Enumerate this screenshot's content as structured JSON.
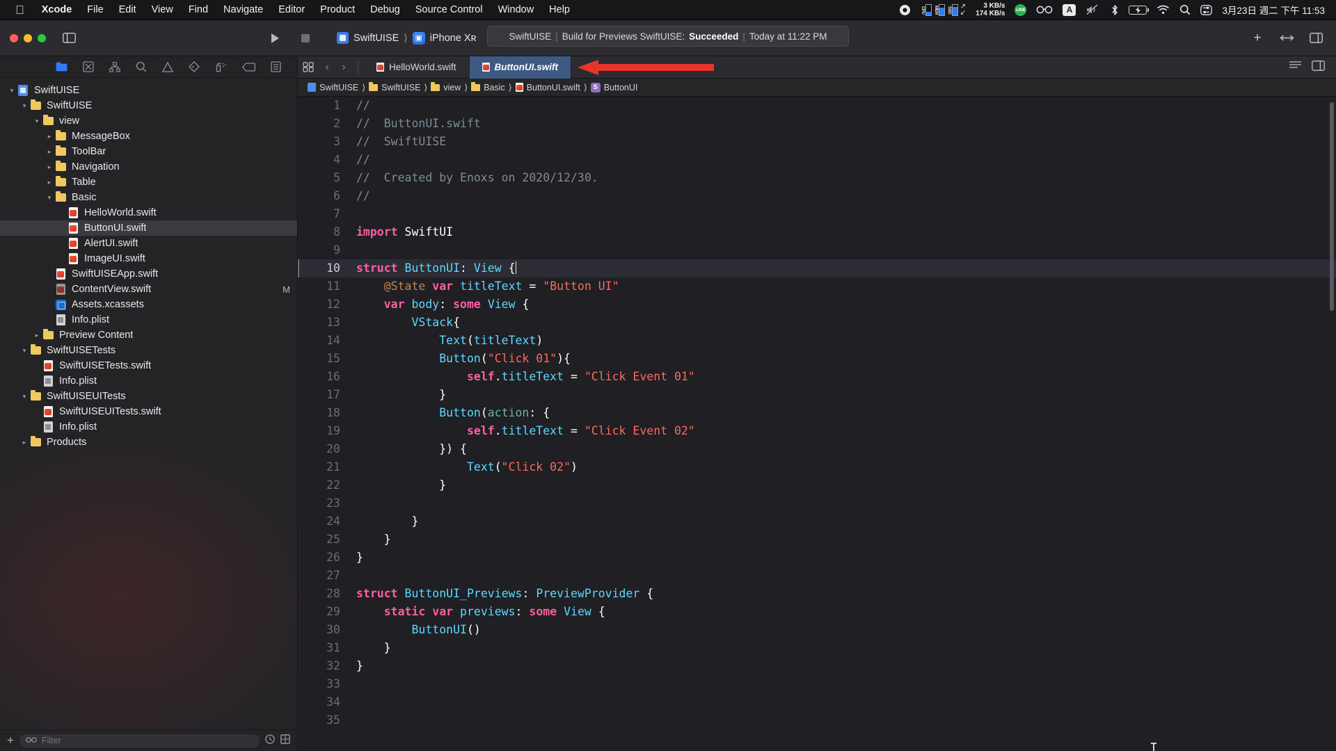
{
  "menubar": {
    "apple": "apple-logo",
    "items": [
      "Xcode",
      "File",
      "Edit",
      "View",
      "Find",
      "Navigate",
      "Editor",
      "Product",
      "Debug",
      "Source Control",
      "Window",
      "Help"
    ],
    "app_name": "Xcode",
    "status": {
      "record_icon": "record-icon",
      "cpu_label": "CPU",
      "mem_label": "MEM",
      "ssd_label": "SSD",
      "net_up": "3 KB/s",
      "net_down": "174 KB/s",
      "line_icon": "LINE",
      "glasses_icon": "glasses-icon",
      "input_source": "A",
      "volume_icon": "volume-muted-icon",
      "bluetooth_icon": "bluetooth-icon",
      "battery_icon": "battery-charging-icon",
      "wifi_icon": "wifi-icon",
      "search_icon": "search-icon",
      "control_center_icon": "control-center-icon",
      "datetime": "3月23日 週二 下午 11:53"
    }
  },
  "toolbar": {
    "sidebar_toggle": "sidebar-toggle-icon",
    "run_button": "run-button",
    "stop_button": "stop-button",
    "scheme": "SwiftUISE",
    "destination": "iPhone Xʀ",
    "activity": {
      "project": "SwiftUISE",
      "action": "Build for Previews SwiftUISE:",
      "result": "Succeeded",
      "time": "Today at 11:22 PM"
    },
    "add_button": "+",
    "right_icons": [
      "library-add-icon",
      "inspector-toggle-icon"
    ]
  },
  "navigator": {
    "tabs": [
      {
        "name": "project-navigator",
        "icon": "folder-icon",
        "active": true
      },
      {
        "name": "source-control-navigator",
        "icon": "source-control-icon",
        "active": false
      },
      {
        "name": "symbol-navigator",
        "icon": "hierarchy-icon",
        "active": false
      },
      {
        "name": "find-navigator",
        "icon": "search-icon",
        "active": false
      },
      {
        "name": "issue-navigator",
        "icon": "warning-icon",
        "active": false
      },
      {
        "name": "test-navigator",
        "icon": "diamond-icon",
        "active": false
      },
      {
        "name": "debug-navigator",
        "icon": "spray-icon",
        "active": false
      },
      {
        "name": "breakpoint-navigator",
        "icon": "tag-icon",
        "active": false
      },
      {
        "name": "report-navigator",
        "icon": "report-icon",
        "active": false
      }
    ],
    "tree": [
      {
        "label": "SwiftUISE",
        "depth": 0,
        "icon": "project",
        "twisty": "open",
        "selected": false,
        "status": ""
      },
      {
        "label": "SwiftUISE",
        "depth": 1,
        "icon": "folder",
        "twisty": "open",
        "selected": false,
        "status": ""
      },
      {
        "label": "view",
        "depth": 2,
        "icon": "folder",
        "twisty": "open",
        "selected": false,
        "status": ""
      },
      {
        "label": "MessageBox",
        "depth": 3,
        "icon": "folder",
        "twisty": "closed",
        "selected": false,
        "status": ""
      },
      {
        "label": "ToolBar",
        "depth": 3,
        "icon": "folder",
        "twisty": "closed",
        "selected": false,
        "status": ""
      },
      {
        "label": "Navigation",
        "depth": 3,
        "icon": "folder",
        "twisty": "closed",
        "selected": false,
        "status": ""
      },
      {
        "label": "Table",
        "depth": 3,
        "icon": "folder",
        "twisty": "closed",
        "selected": false,
        "status": ""
      },
      {
        "label": "Basic",
        "depth": 3,
        "icon": "folder",
        "twisty": "open",
        "selected": false,
        "status": ""
      },
      {
        "label": "HelloWorld.swift",
        "depth": 4,
        "icon": "swift",
        "twisty": "none",
        "selected": false,
        "status": ""
      },
      {
        "label": "ButtonUI.swift",
        "depth": 4,
        "icon": "swift",
        "twisty": "none",
        "selected": true,
        "status": ""
      },
      {
        "label": "AlertUI.swift",
        "depth": 4,
        "icon": "swift",
        "twisty": "none",
        "selected": false,
        "status": ""
      },
      {
        "label": "ImageUI.swift",
        "depth": 4,
        "icon": "swift",
        "twisty": "none",
        "selected": false,
        "status": ""
      },
      {
        "label": "SwiftUISEApp.swift",
        "depth": 3,
        "icon": "swift",
        "twisty": "none",
        "selected": false,
        "status": ""
      },
      {
        "label": "ContentView.swift",
        "depth": 3,
        "icon": "swift-dim",
        "twisty": "none",
        "selected": false,
        "status": "M"
      },
      {
        "label": "Assets.xcassets",
        "depth": 3,
        "icon": "assets",
        "twisty": "none",
        "selected": false,
        "status": ""
      },
      {
        "label": "Info.plist",
        "depth": 3,
        "icon": "plist",
        "twisty": "none",
        "selected": false,
        "status": ""
      },
      {
        "label": "Preview Content",
        "depth": 2,
        "icon": "folder",
        "twisty": "closed",
        "selected": false,
        "status": ""
      },
      {
        "label": "SwiftUISETests",
        "depth": 1,
        "icon": "folder",
        "twisty": "open",
        "selected": false,
        "status": ""
      },
      {
        "label": "SwiftUISETests.swift",
        "depth": 2,
        "icon": "swift",
        "twisty": "none",
        "selected": false,
        "status": ""
      },
      {
        "label": "Info.plist",
        "depth": 2,
        "icon": "plist",
        "twisty": "none",
        "selected": false,
        "status": ""
      },
      {
        "label": "SwiftUISEUITests",
        "depth": 1,
        "icon": "folder",
        "twisty": "open",
        "selected": false,
        "status": ""
      },
      {
        "label": "SwiftUISEUITests.swift",
        "depth": 2,
        "icon": "swift",
        "twisty": "none",
        "selected": false,
        "status": ""
      },
      {
        "label": "Info.plist",
        "depth": 2,
        "icon": "plist",
        "twisty": "none",
        "selected": false,
        "status": ""
      },
      {
        "label": "Products",
        "depth": 1,
        "icon": "folder",
        "twisty": "closed",
        "selected": false,
        "status": ""
      }
    ],
    "footer": {
      "add_label": "+",
      "filter_placeholder": "Filter",
      "filter_value": "",
      "recent_icon": "clock-icon",
      "sourcecontrol_icon": "filter-sc-icon"
    }
  },
  "editor": {
    "tabs": [
      {
        "label": "HelloWorld.swift",
        "active": false
      },
      {
        "label": "ButtonUI.swift",
        "active": true
      }
    ],
    "annotation": {
      "type": "red-arrow",
      "color": "#e8342a"
    },
    "breadcrumb": [
      {
        "label": "SwiftUISE",
        "icon": "project"
      },
      {
        "label": "SwiftUISE",
        "icon": "folder"
      },
      {
        "label": "view",
        "icon": "folder"
      },
      {
        "label": "Basic",
        "icon": "folder"
      },
      {
        "label": "ButtonUI.swift",
        "icon": "swift"
      },
      {
        "label": "ButtonUI",
        "icon": "symbol-s"
      }
    ],
    "current_line": 10,
    "code": [
      {
        "n": 1,
        "t": [
          [
            "cm",
            "//"
          ]
        ]
      },
      {
        "n": 2,
        "t": [
          [
            "cm",
            "//  ButtonUI.swift"
          ]
        ]
      },
      {
        "n": 3,
        "t": [
          [
            "cm",
            "//  SwiftUISE"
          ]
        ]
      },
      {
        "n": 4,
        "t": [
          [
            "cm",
            "//"
          ]
        ]
      },
      {
        "n": 5,
        "t": [
          [
            "cm",
            "//  Created by Enoxs on 2020/12/30."
          ]
        ]
      },
      {
        "n": 6,
        "t": [
          [
            "cm",
            "//"
          ]
        ]
      },
      {
        "n": 7,
        "t": []
      },
      {
        "n": 8,
        "t": [
          [
            "k",
            "import"
          ],
          [
            "pl",
            " SwiftUI"
          ]
        ]
      },
      {
        "n": 9,
        "t": []
      },
      {
        "n": 10,
        "t": [
          [
            "k",
            "struct"
          ],
          [
            "pl",
            " "
          ],
          [
            "ty",
            "ButtonUI"
          ],
          [
            "pl",
            ": "
          ],
          [
            "ty",
            "View"
          ],
          [
            "pl",
            " {"
          ]
        ],
        "caret": true
      },
      {
        "n": 11,
        "t": [
          [
            "pl",
            "    "
          ],
          [
            "at",
            "@State"
          ],
          [
            "pl",
            " "
          ],
          [
            "k",
            "var"
          ],
          [
            "pl",
            " "
          ],
          [
            "ty",
            "titleText"
          ],
          [
            "pl",
            " = "
          ],
          [
            "st",
            "\"Button UI\""
          ]
        ]
      },
      {
        "n": 12,
        "t": [
          [
            "pl",
            "    "
          ],
          [
            "k",
            "var"
          ],
          [
            "pl",
            " "
          ],
          [
            "ty",
            "body"
          ],
          [
            "pl",
            ": "
          ],
          [
            "k",
            "some"
          ],
          [
            "pl",
            " "
          ],
          [
            "ty",
            "View"
          ],
          [
            "pl",
            " {"
          ]
        ]
      },
      {
        "n": 13,
        "t": [
          [
            "pl",
            "        "
          ],
          [
            "ty",
            "VStack"
          ],
          [
            "pl",
            "{"
          ]
        ]
      },
      {
        "n": 14,
        "t": [
          [
            "pl",
            "            "
          ],
          [
            "ty",
            "Text"
          ],
          [
            "pl",
            "("
          ],
          [
            "ty",
            "titleText"
          ],
          [
            "pl",
            ")"
          ]
        ]
      },
      {
        "n": 15,
        "t": [
          [
            "pl",
            "            "
          ],
          [
            "ty",
            "Button"
          ],
          [
            "pl",
            "("
          ],
          [
            "st",
            "\"Click 01\""
          ],
          [
            "pl",
            "){"
          ]
        ]
      },
      {
        "n": 16,
        "t": [
          [
            "pl",
            "                "
          ],
          [
            "k",
            "self"
          ],
          [
            "pl",
            "."
          ],
          [
            "ty",
            "titleText"
          ],
          [
            "pl",
            " = "
          ],
          [
            "st",
            "\"Click Event 01\""
          ]
        ]
      },
      {
        "n": 17,
        "t": [
          [
            "pl",
            "            }"
          ]
        ]
      },
      {
        "n": 18,
        "t": [
          [
            "pl",
            "            "
          ],
          [
            "ty",
            "Button"
          ],
          [
            "pl",
            "("
          ],
          [
            "fn",
            "action"
          ],
          [
            "pl",
            ": {"
          ]
        ]
      },
      {
        "n": 19,
        "t": [
          [
            "pl",
            "                "
          ],
          [
            "k",
            "self"
          ],
          [
            "pl",
            "."
          ],
          [
            "ty",
            "titleText"
          ],
          [
            "pl",
            " = "
          ],
          [
            "st",
            "\"Click Event 02\""
          ]
        ]
      },
      {
        "n": 20,
        "t": [
          [
            "pl",
            "            }) {"
          ]
        ]
      },
      {
        "n": 21,
        "t": [
          [
            "pl",
            "                "
          ],
          [
            "ty",
            "Text"
          ],
          [
            "pl",
            "("
          ],
          [
            "st",
            "\"Click 02\""
          ],
          [
            "pl",
            ")"
          ]
        ]
      },
      {
        "n": 22,
        "t": [
          [
            "pl",
            "            }"
          ]
        ]
      },
      {
        "n": 23,
        "t": []
      },
      {
        "n": 24,
        "t": [
          [
            "pl",
            "        }"
          ]
        ]
      },
      {
        "n": 25,
        "t": [
          [
            "pl",
            "    }"
          ]
        ]
      },
      {
        "n": 26,
        "t": [
          [
            "pl",
            "}"
          ]
        ]
      },
      {
        "n": 27,
        "t": []
      },
      {
        "n": 28,
        "t": [
          [
            "k",
            "struct"
          ],
          [
            "pl",
            " "
          ],
          [
            "ty",
            "ButtonUI_Previews"
          ],
          [
            "pl",
            ": "
          ],
          [
            "ty",
            "PreviewProvider"
          ],
          [
            "pl",
            " {"
          ]
        ]
      },
      {
        "n": 29,
        "t": [
          [
            "pl",
            "    "
          ],
          [
            "k",
            "static"
          ],
          [
            "pl",
            " "
          ],
          [
            "k",
            "var"
          ],
          [
            "pl",
            " "
          ],
          [
            "ty",
            "previews"
          ],
          [
            "pl",
            ": "
          ],
          [
            "k",
            "some"
          ],
          [
            "pl",
            " "
          ],
          [
            "ty",
            "View"
          ],
          [
            "pl",
            " {"
          ]
        ]
      },
      {
        "n": 30,
        "t": [
          [
            "pl",
            "        "
          ],
          [
            "ty",
            "ButtonUI"
          ],
          [
            "pl",
            "()"
          ]
        ]
      },
      {
        "n": 31,
        "t": [
          [
            "pl",
            "    }"
          ]
        ]
      },
      {
        "n": 32,
        "t": [
          [
            "pl",
            "}"
          ]
        ]
      },
      {
        "n": 33,
        "t": []
      },
      {
        "n": 34,
        "t": []
      },
      {
        "n": 35,
        "t": []
      }
    ]
  },
  "colors": {
    "keyword": "#fc5fa3",
    "type": "#5dd8ff",
    "string": "#fc6a5d",
    "comment": "#7f8c98",
    "accent": "#2f7cf6",
    "annotation_arrow": "#e8342a",
    "editor_bg": "#1f1f24"
  }
}
